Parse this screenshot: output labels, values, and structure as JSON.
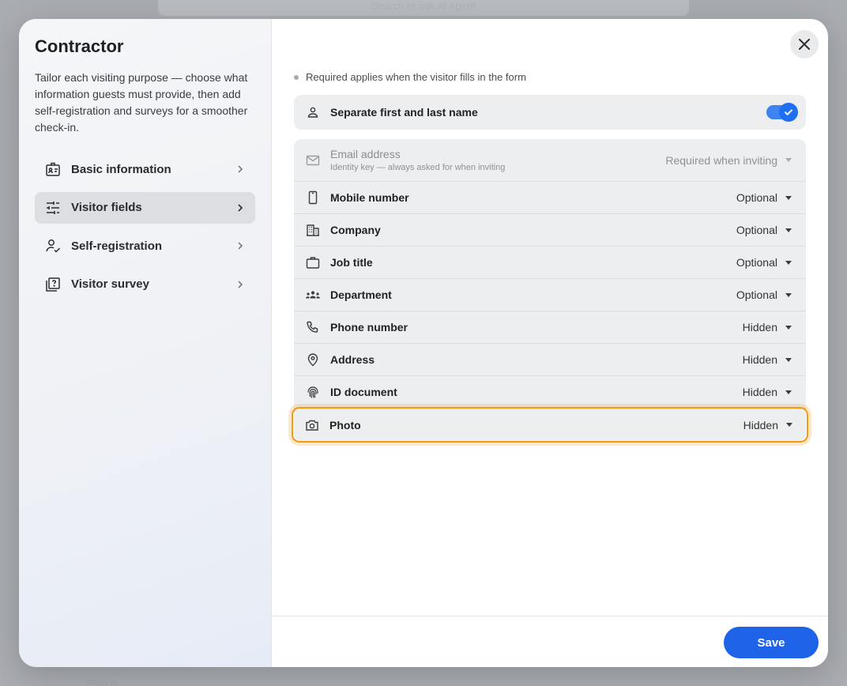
{
  "background": {
    "search_placeholder": "Search or ask Al Agent",
    "bottom_label": "Sign in"
  },
  "sidebar": {
    "title": "Contractor",
    "description": "Tailor each visiting purpose — choose what information guests must provide, then add self-registration and surveys for a smoother check-in.",
    "items": [
      {
        "label": "Basic information",
        "icon": "id-badge-icon",
        "active": false
      },
      {
        "label": "Visitor fields",
        "icon": "sliders-icon",
        "active": true
      },
      {
        "label": "Self-registration",
        "icon": "person-check-icon",
        "active": false
      },
      {
        "label": "Visitor survey",
        "icon": "survey-icon",
        "active": false
      }
    ]
  },
  "main": {
    "hint": "Required applies when the visitor fills in the form",
    "toggle_row": {
      "label": "Separate first and last name",
      "enabled": true
    },
    "fields": [
      {
        "label": "Email address",
        "sublabel": "Identity key — always asked for when inviting",
        "value": "Required when inviting",
        "icon": "mail-icon"
      },
      {
        "label": "Mobile number",
        "value": "Optional",
        "icon": "phone-mobile-icon"
      },
      {
        "label": "Company",
        "value": "Optional",
        "icon": "building-icon"
      },
      {
        "label": "Job title",
        "value": "Optional",
        "icon": "briefcase-icon"
      },
      {
        "label": "Department",
        "value": "Optional",
        "icon": "group-icon"
      },
      {
        "label": "Phone number",
        "value": "Hidden",
        "icon": "phone-icon"
      },
      {
        "label": "Address",
        "value": "Hidden",
        "icon": "location-pin-icon"
      },
      {
        "label": "ID document",
        "value": "Hidden",
        "icon": "fingerprint-icon"
      },
      {
        "label": "Photo",
        "value": "Hidden",
        "icon": "camera-icon",
        "highlighted": true
      }
    ],
    "save_label": "Save"
  },
  "colors": {
    "accent": "#1f64e8",
    "highlight": "#f09a18"
  }
}
